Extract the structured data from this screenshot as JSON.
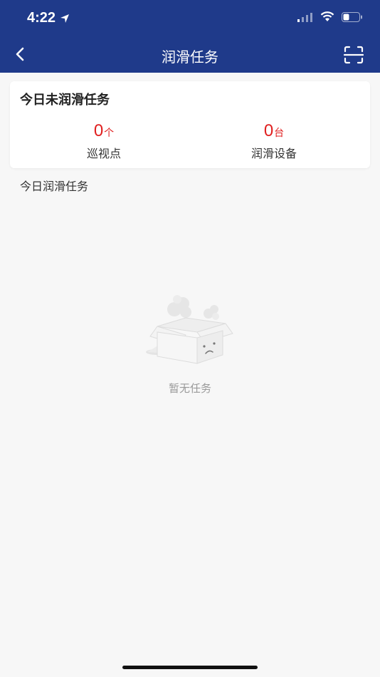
{
  "status_bar": {
    "time": "4:22"
  },
  "nav": {
    "title": "润滑任务",
    "back_icon": "chevron-left-icon",
    "scan_icon": "scan-icon"
  },
  "summary": {
    "title": "今日未润滑任务",
    "stats": [
      {
        "value": "0",
        "unit": "个",
        "label": "巡视点"
      },
      {
        "value": "0",
        "unit": "台",
        "label": "润滑设备"
      }
    ]
  },
  "today_section": {
    "label": "今日润滑任务"
  },
  "empty_state": {
    "icon": "empty-box-icon",
    "text": "暂无任务"
  },
  "colors": {
    "header_bg": "#1f3a8a",
    "accent_red": "#e02020",
    "page_bg": "#f7f7f7"
  }
}
